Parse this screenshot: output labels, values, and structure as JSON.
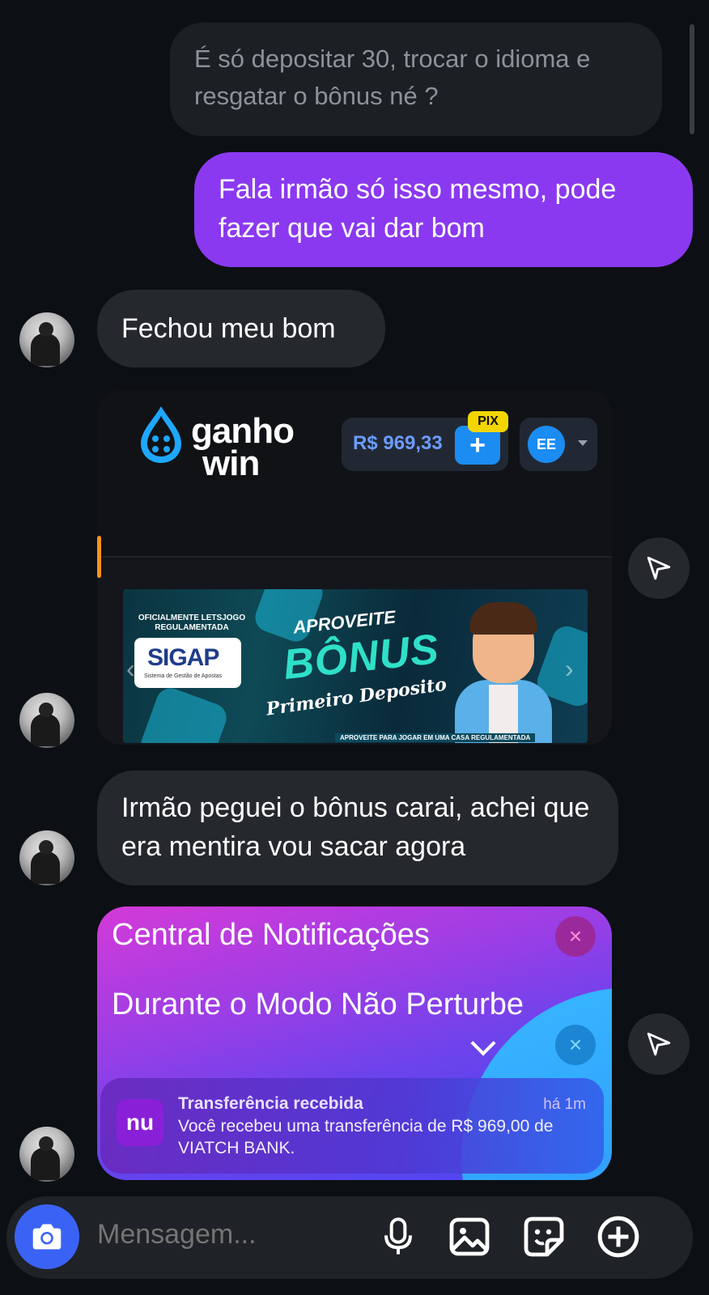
{
  "messages": {
    "reply_preview": "É só depositar 30, trocar o idioma e resgatar o bônus né ?",
    "sent": "Fala irmão só isso mesmo, pode fazer que vai dar bom",
    "received_1": "Fechou meu bom",
    "received_2": "Irmão peguei o bônus carai, achei que era mentira vou sacar agora"
  },
  "casino_card": {
    "logo_line1": "ganho",
    "logo_line2": "win",
    "balance": "R$ 969,33",
    "pix_tag": "PIX",
    "pix_button": "+",
    "language": "EE",
    "banner": {
      "oficial": "OFICIALMENTE LETSJOGO REGULAMENTADA",
      "sigap": "SIGAP",
      "sigap_sub": "Sistema de Gestão de Apostas",
      "aproveite": "APROVEITE",
      "bonus": "BÔNUS",
      "primeiro": "Primeiro Deposito",
      "footer": "APROVEITE PARA JOGAR EM UMA CASA REGULAMENTADA"
    }
  },
  "notification_card": {
    "central": "Central de Notificações",
    "durante": "Durante o Modo Não Perturbe",
    "close_glyph": "×",
    "app_icon": "nu",
    "title": "Transferência recebida",
    "time": "há 1m",
    "body": "Você recebeu uma transferência de R$ 969,00 de VIATCH BANK."
  },
  "composer": {
    "placeholder": "Mensagem...",
    "icons": [
      "camera-icon",
      "microphone-icon",
      "gallery-icon",
      "sticker-icon",
      "add-circle-icon"
    ]
  },
  "colors": {
    "sent_bubble": "#8a39f0",
    "received_bubble": "#25282d",
    "camera_button": "#3a63f5",
    "background": "#0c1014"
  }
}
